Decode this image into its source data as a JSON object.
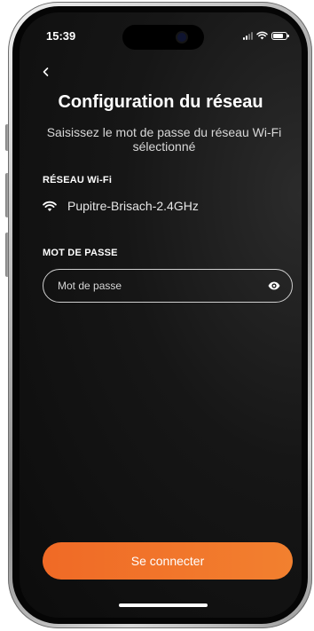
{
  "status_bar": {
    "time": "15:39"
  },
  "header": {
    "back_icon": "chevron-left-icon",
    "title": "Configuration du réseau",
    "subtitle": "Saisissez le mot de passe du réseau Wi-Fi sélectionné"
  },
  "wifi": {
    "section_label": "RÉSEAU Wi-Fi",
    "icon": "wifi-icon",
    "network_name": "Pupitre-Brisach-2.4GHz"
  },
  "password": {
    "section_label": "MOT DE PASSE",
    "value": "",
    "placeholder": "Mot de passe",
    "toggle_icon": "eye-icon"
  },
  "actions": {
    "connect_label": "Se connecter"
  },
  "colors": {
    "accent": "#f2782c",
    "background": "#111111",
    "text": "#ffffff"
  }
}
